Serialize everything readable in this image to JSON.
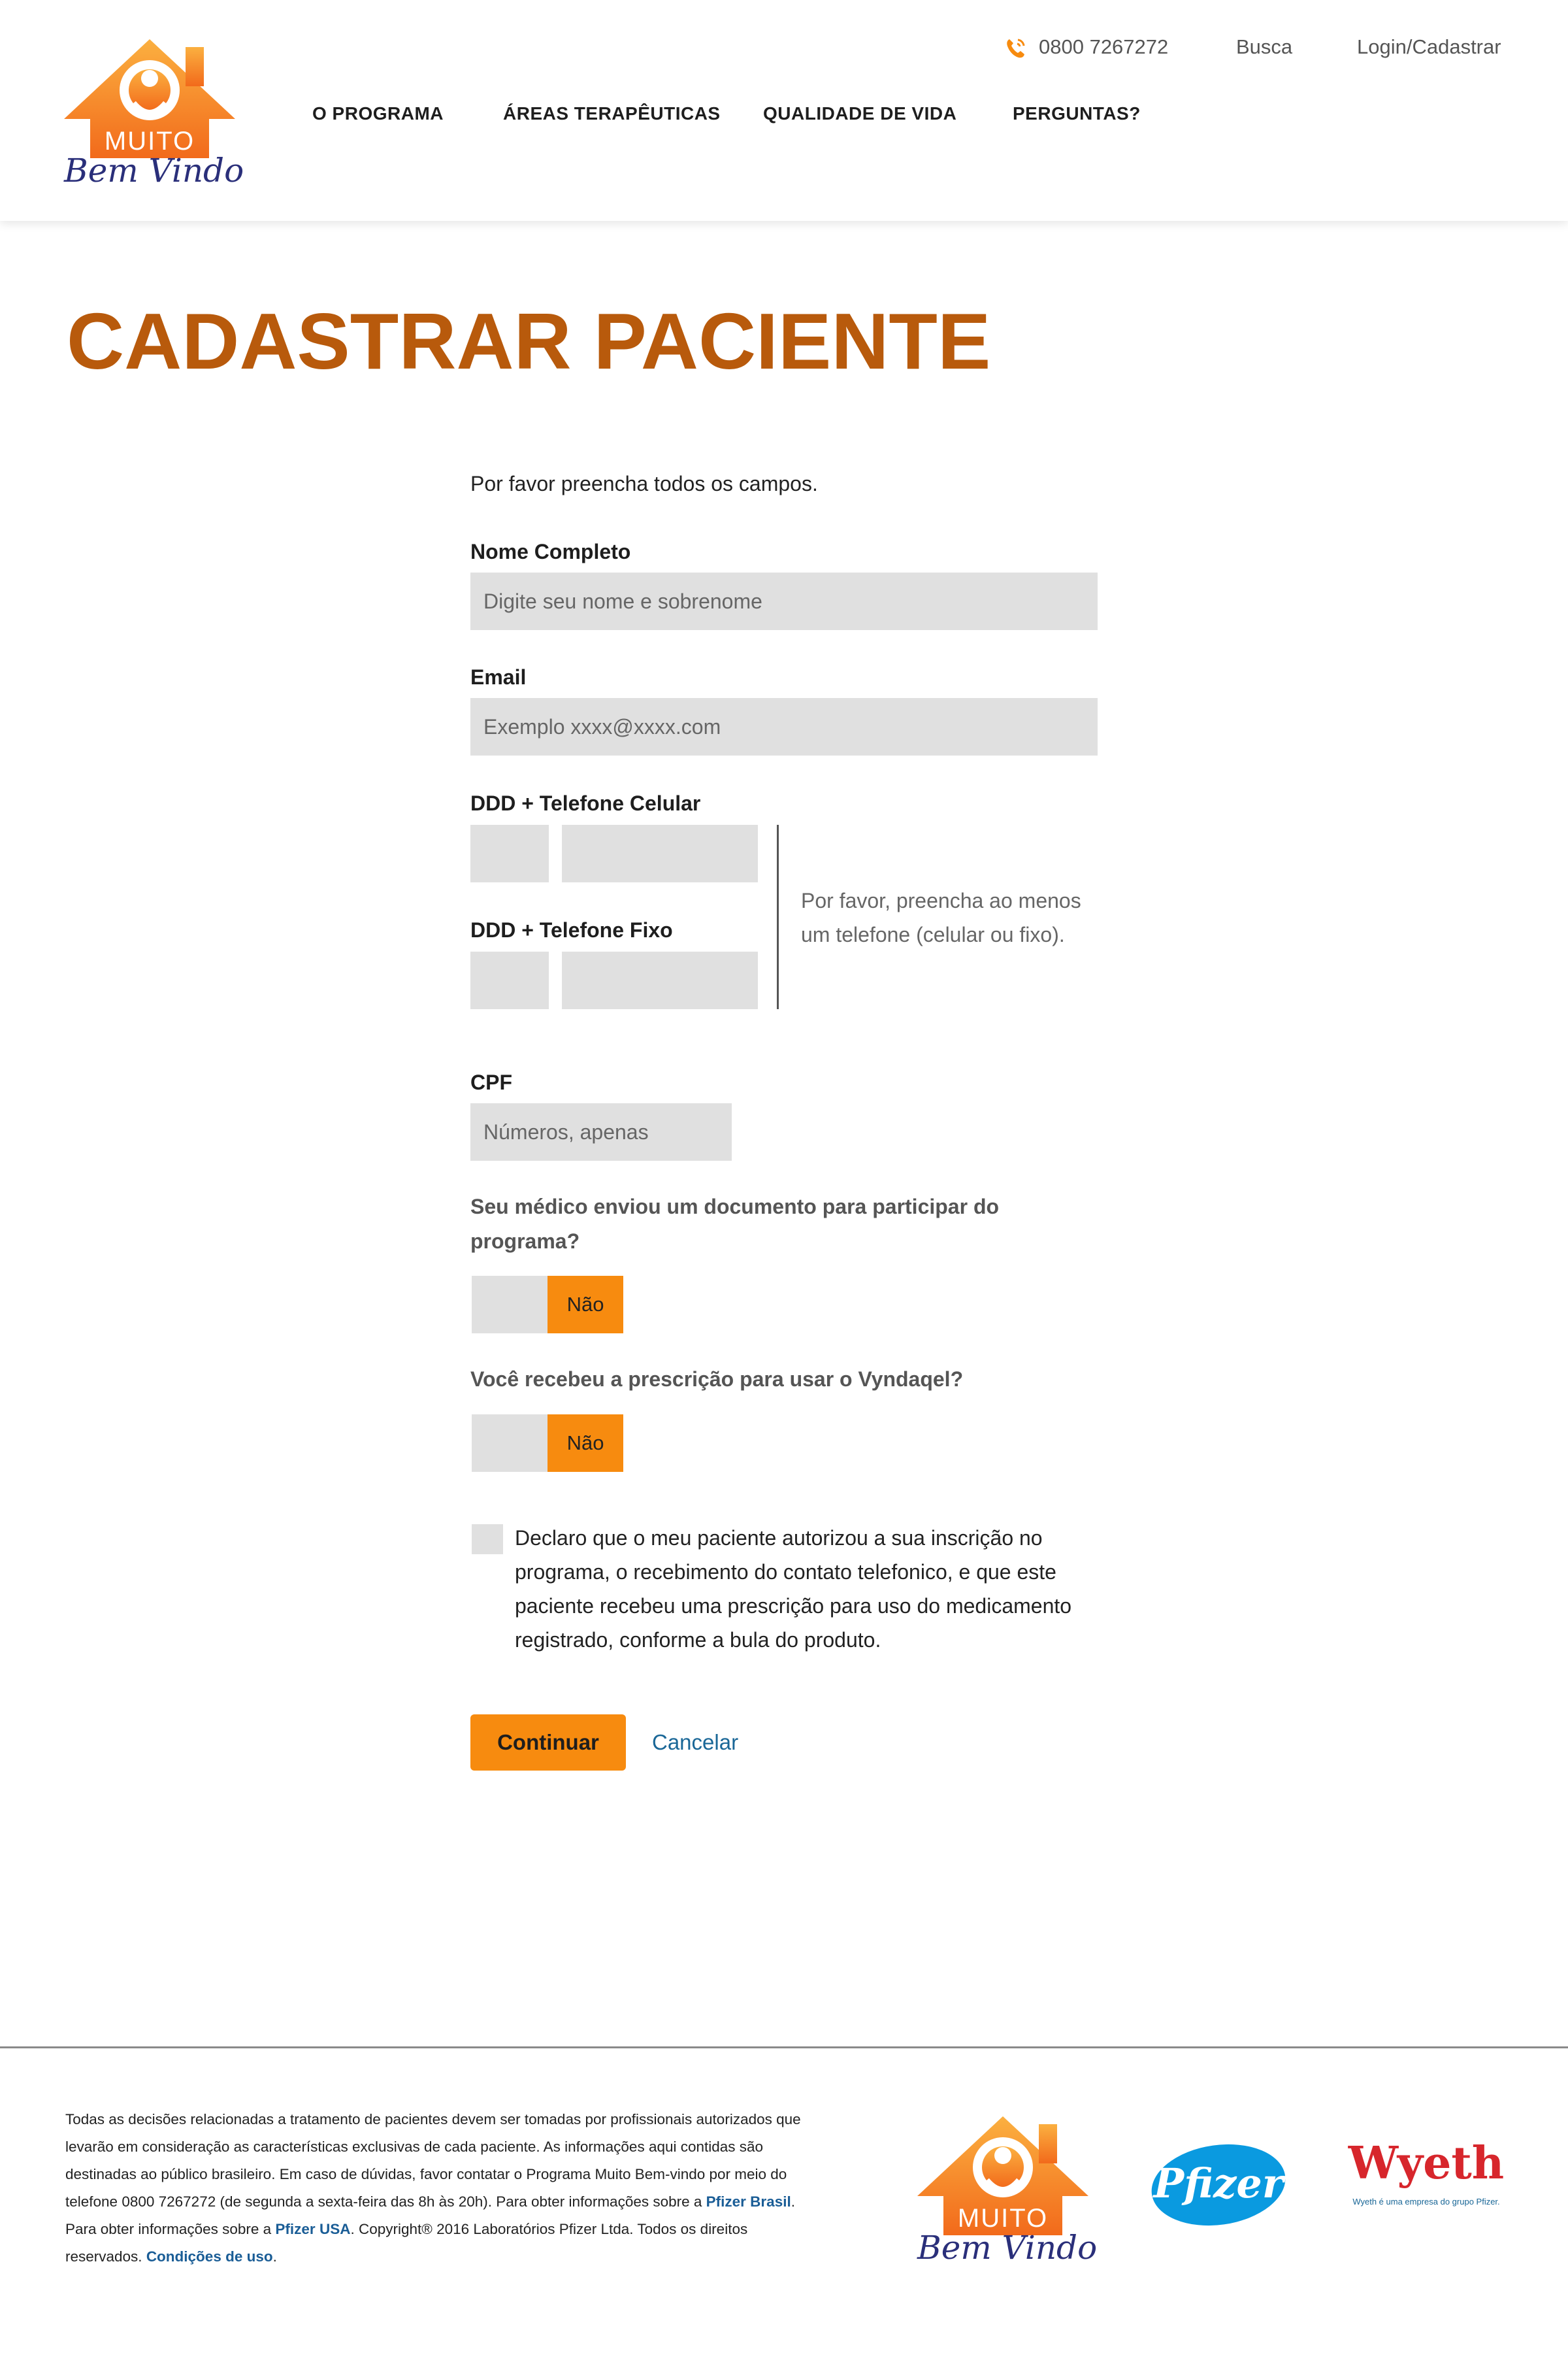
{
  "header": {
    "logo_muito": "MUITO",
    "logo_bem_vindo": "Bem Vindo",
    "phone": "0800 7267272",
    "search": "Busca",
    "login": "Login/Cadastrar",
    "nav": [
      "O PROGRAMA",
      "ÁREAS TERAPÊUTICAS",
      "QUALIDADE DE VIDA",
      "PERGUNTAS?"
    ]
  },
  "page": {
    "title": "CADASTRAR PACIENTE"
  },
  "form": {
    "intro": "Por favor preencha todos os campos.",
    "name_label": "Nome Completo",
    "name_placeholder": "Digite seu nome e sobrenome",
    "email_label": "Email",
    "email_placeholder": "Exemplo xxxx@xxxx.com",
    "cell_label": "DDD + Telefone Celular",
    "landline_label": "DDD + Telefone Fixo",
    "phone_note": "Por favor, preencha ao menos um telefone (celular ou fixo).",
    "cpf_label": "CPF",
    "cpf_placeholder": "Números, apenas",
    "q1_label": "Seu médico enviou um documento para participar do programa?",
    "q1_selected": "Não",
    "q2_label": "Você recebeu a prescrição para usar o Vyndaqel?",
    "q2_selected": "Não",
    "consent": "Declaro que o meu paciente autorizou a sua inscrição no programa, o recebimento do contato telefonico, e que este paciente recebeu uma prescrição para uso do medicamento registrado, conforme a bula do produto.",
    "continue_label": "Continuar",
    "cancel_label": "Cancelar"
  },
  "footer": {
    "text_1": "Todas as decisões relacionadas a tratamento de pacientes devem ser tomadas por profissionais autorizados que levarão em consideração as características exclusivas de cada paciente. As informações aqui contidas são destinadas ao público brasileiro. Em caso de dúvidas, favor contatar o Programa Muito Bem-vindo por meio do telefone 0800 7267272 (de segunda a sexta-feira das 8h às 20h). Para obter informações sobre a ",
    "link_pfizer_brasil": "Pfizer Brasil",
    "text_2": ". Para obter informações sobre a ",
    "link_pfizer_usa": "Pfizer USA",
    "text_3": ". Copyright® 2016 Laboratórios Pfizer Ltda. Todos os direitos reservados. ",
    "link_terms": "Condições de uso",
    "text_4": ".",
    "logo_muito": "MUITO",
    "logo_bem_vindo": "Bem Vindo",
    "pfizer_logo": "Pfizer",
    "wyeth_logo": "Wyeth",
    "wyeth_tagline": "Wyeth é uma empresa do grupo Pfizer."
  },
  "colors": {
    "accent_orange": "#f78b0f",
    "title_orange": "#b85a0c",
    "link_blue": "#1a6797",
    "pfizer_blue": "#0a9ae0",
    "wyeth_red": "#d7262c"
  }
}
